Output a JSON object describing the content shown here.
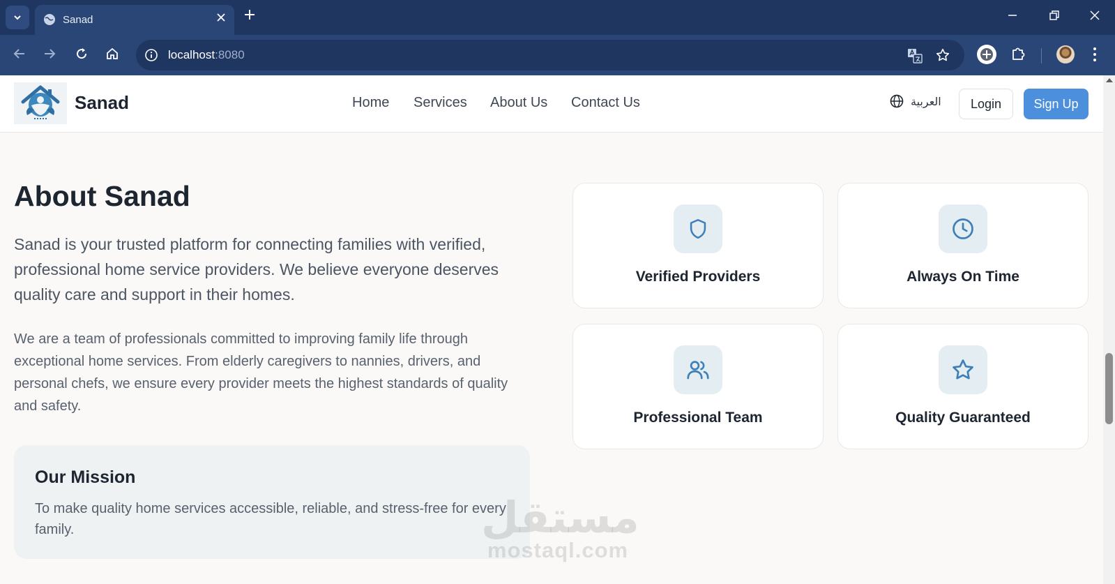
{
  "browser": {
    "tab": {
      "title": "Sanad"
    },
    "omnibox": {
      "host": "localhost",
      "port": ":8080"
    }
  },
  "header": {
    "brand": "Sanad",
    "nav": [
      {
        "label": "Home"
      },
      {
        "label": "Services"
      },
      {
        "label": "About Us"
      },
      {
        "label": "Contact Us"
      }
    ],
    "language_label": "العربية",
    "login_label": "Login",
    "signup_label": "Sign Up"
  },
  "about": {
    "title": "About Sanad",
    "lead": "Sanad is your trusted platform for connecting families with verified, professional home service providers. We believe everyone deserves quality care and support in their homes.",
    "body": "We are a team of professionals committed to improving family life through exceptional home services. From elderly caregivers to nannies, drivers, and personal chefs, we ensure every provider meets the highest standards of quality and safety.",
    "mission": {
      "title": "Our Mission",
      "text": "To make quality home services accessible, reliable, and stress-free for every family."
    }
  },
  "features": [
    {
      "label": "Verified Providers",
      "icon": "shield-icon"
    },
    {
      "label": "Always On Time",
      "icon": "clock-icon"
    },
    {
      "label": "Professional Team",
      "icon": "users-icon"
    },
    {
      "label": "Quality Guaranteed",
      "icon": "star-icon"
    }
  ],
  "watermark": {
    "arabic": "مستقل",
    "latin": "mostaql.com"
  },
  "colors": {
    "accent": "#4c8fdc",
    "icon_stroke": "#3f7fb8",
    "chrome_dark": "#1f3660",
    "chrome": "#2a4676"
  }
}
